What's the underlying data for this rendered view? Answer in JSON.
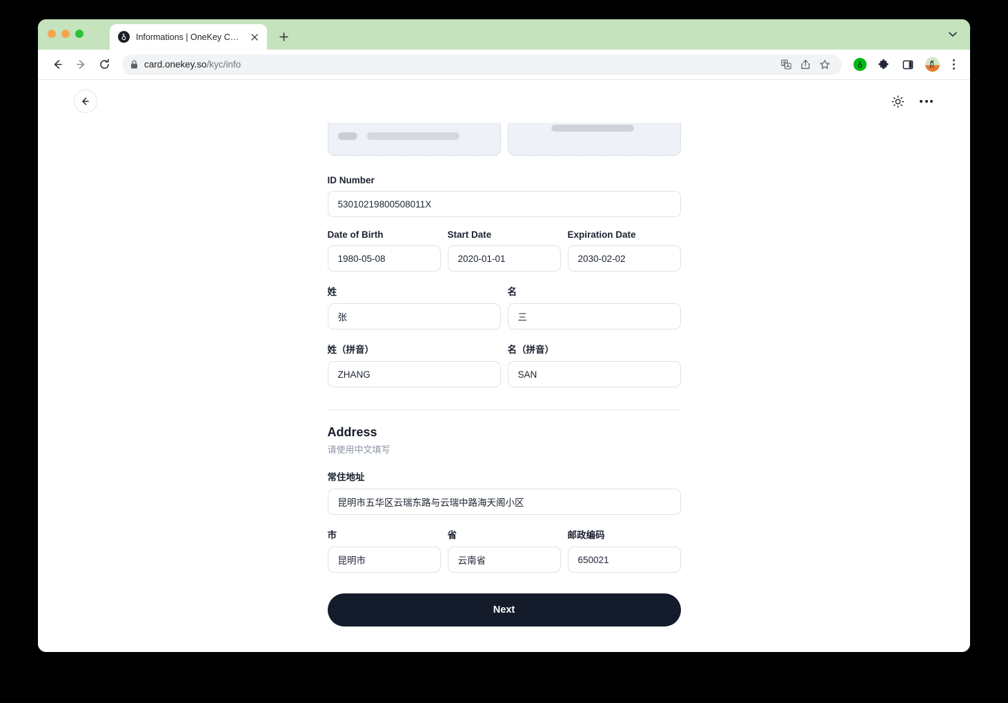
{
  "browser": {
    "tab": {
      "title": "Informations | OneKey Card",
      "favicon": "onekey-logo-icon",
      "close_icon": "close-icon"
    },
    "new_tab_icon": "plus-icon",
    "tab_search_icon": "chevron-down-icon",
    "nav": {
      "back_icon": "arrow-left-icon",
      "forward_icon": "arrow-right-icon",
      "reload_icon": "reload-icon"
    },
    "omnibox": {
      "lock_icon": "lock-icon",
      "url_host": "card.onekey.so",
      "url_path": "/kyc/info",
      "translate_icon": "translate-icon",
      "share_icon": "share-icon",
      "bookmark_icon": "star-icon"
    },
    "extensions": {
      "onekey_icon": "onekey-extension-icon",
      "puzzle_icon": "extensions-puzzle-icon",
      "side_panel_icon": "side-panel-icon",
      "avatar_icon": "profile-avatar-icon",
      "menu_icon": "three-dot-menu-icon"
    },
    "traffic_lights": [
      "close",
      "minimize",
      "maximize"
    ]
  },
  "page": {
    "header": {
      "back_icon": "arrow-left-icon",
      "theme_icon": "sun-icon",
      "more_icon": "more-horizontal-icon"
    },
    "skeleton": {
      "left_card": "loading-placeholder",
      "right_card": "loading-placeholder"
    },
    "form": {
      "id_number": {
        "label": "ID Number",
        "value": "53010219800508011X"
      },
      "date_of_birth": {
        "label": "Date of Birth",
        "value": "1980-05-08"
      },
      "start_date": {
        "label": "Start Date",
        "value": "2020-01-01"
      },
      "expiration_date": {
        "label": "Expiration Date",
        "value": "2030-02-02"
      },
      "surname": {
        "label": "姓",
        "value": "张"
      },
      "given_name": {
        "label": "名",
        "value": "三"
      },
      "surname_pinyin": {
        "label": "姓（拼音）",
        "value": "ZHANG"
      },
      "given_name_pinyin": {
        "label": "名（拼音）",
        "value": "SAN"
      }
    },
    "address": {
      "title": "Address",
      "subtitle": "请使用中文填写",
      "street": {
        "label": "常住地址",
        "value": "昆明市五华区云瑞东路与云瑞中路海天阁小区"
      },
      "city": {
        "label": "市",
        "value": "昆明市"
      },
      "province": {
        "label": "省",
        "value": "云南省"
      },
      "postal_code": {
        "label": "邮政编码",
        "value": "650021"
      }
    },
    "submit": {
      "label": "Next"
    }
  },
  "colors": {
    "tabstrip_green": "#c5e3bd",
    "button_dark": "#141c2b",
    "skeleton_bg": "#eef1f6",
    "accent_green": "#00b812"
  }
}
